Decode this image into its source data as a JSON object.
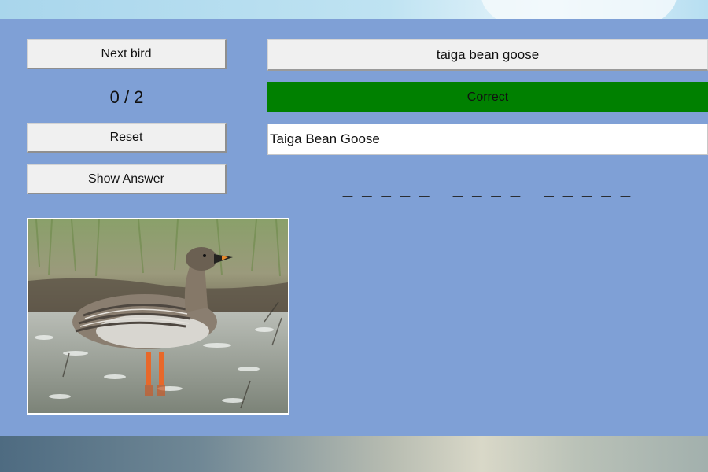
{
  "controls": {
    "next_label": "Next bird",
    "score": "0 / 2",
    "reset_label": "Reset",
    "show_answer_label": "Show Answer"
  },
  "answer": {
    "text": "taiga bean goose"
  },
  "result": {
    "text": "Correct",
    "color": "#008000"
  },
  "guess": {
    "value": "Taiga Bean Goose"
  },
  "hint": {
    "pattern": "_ _ _ _ _   _ _ _ _   _ _ _ _ _"
  },
  "photo": {
    "subject": "goose standing in shallow water"
  },
  "colors": {
    "background": "#7fa0d6",
    "button": "#f0f0f0"
  }
}
